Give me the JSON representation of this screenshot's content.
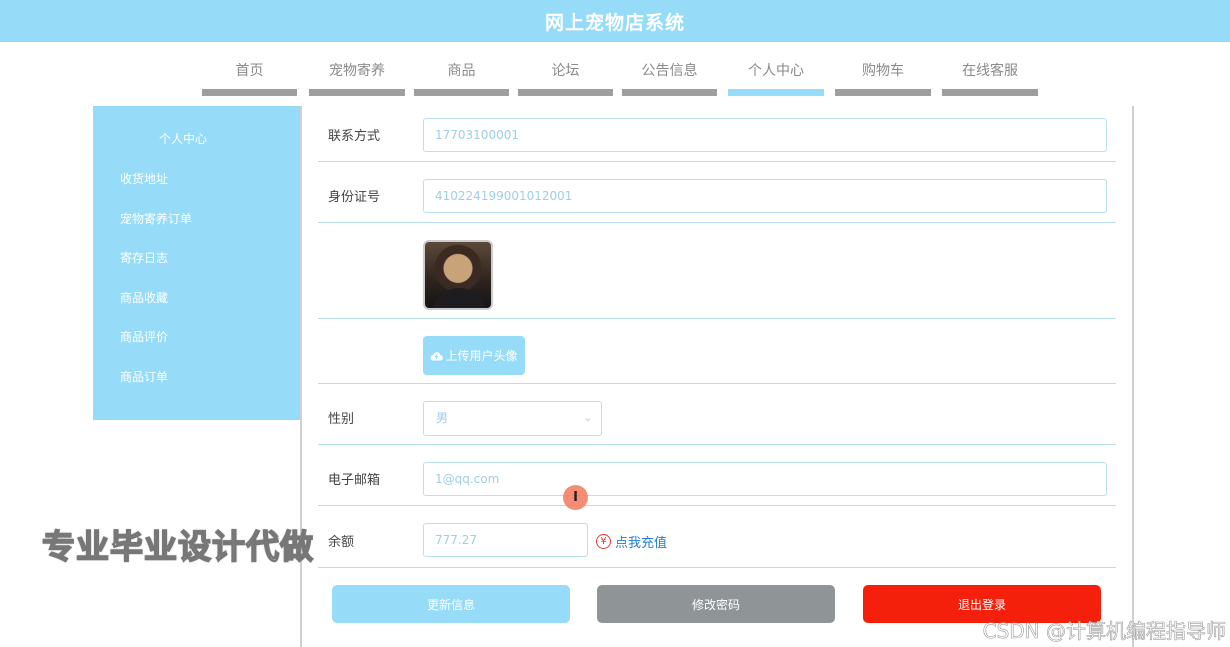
{
  "header": {
    "title": "网上宠物店系统"
  },
  "nav": {
    "items": [
      {
        "label": "首页"
      },
      {
        "label": "宠物寄养"
      },
      {
        "label": "商品"
      },
      {
        "label": "论坛"
      },
      {
        "label": "公告信息"
      },
      {
        "label": "个人中心",
        "active": true
      },
      {
        "label": "购物车"
      },
      {
        "label": "在线客服"
      }
    ]
  },
  "sidebar": {
    "title": "个人中心",
    "items": [
      {
        "label": "收货地址"
      },
      {
        "label": "宠物寄养订单"
      },
      {
        "label": "寄存日志"
      },
      {
        "label": "商品收藏"
      },
      {
        "label": "商品评价"
      },
      {
        "label": "商品订单"
      }
    ]
  },
  "form": {
    "contact": {
      "label": "联系方式",
      "value": "17703100001"
    },
    "idcard": {
      "label": "身份证号",
      "value": "410224199001012001"
    },
    "avatar": {
      "upload_label": "上传用户头像"
    },
    "gender": {
      "label": "性别",
      "value": "男"
    },
    "email": {
      "label": "电子邮箱",
      "value": "1@qq.com"
    },
    "balance": {
      "label": "余额",
      "value": "777.27",
      "recharge_label": "点我充值",
      "recharge_icon": "¥"
    }
  },
  "actions": {
    "update_label": "更新信息",
    "change_password_label": "修改密码",
    "logout_label": "退出登录"
  },
  "overlay": {
    "ad_text": "专业毕业设计代做",
    "watermark": "CSDN @计算机编程指导师",
    "cursor_glyph": "I"
  },
  "colors": {
    "accent": "#96dcf9",
    "danger": "#f5200b",
    "neutral_button": "#8f9496",
    "link": "#1e7fd6"
  }
}
